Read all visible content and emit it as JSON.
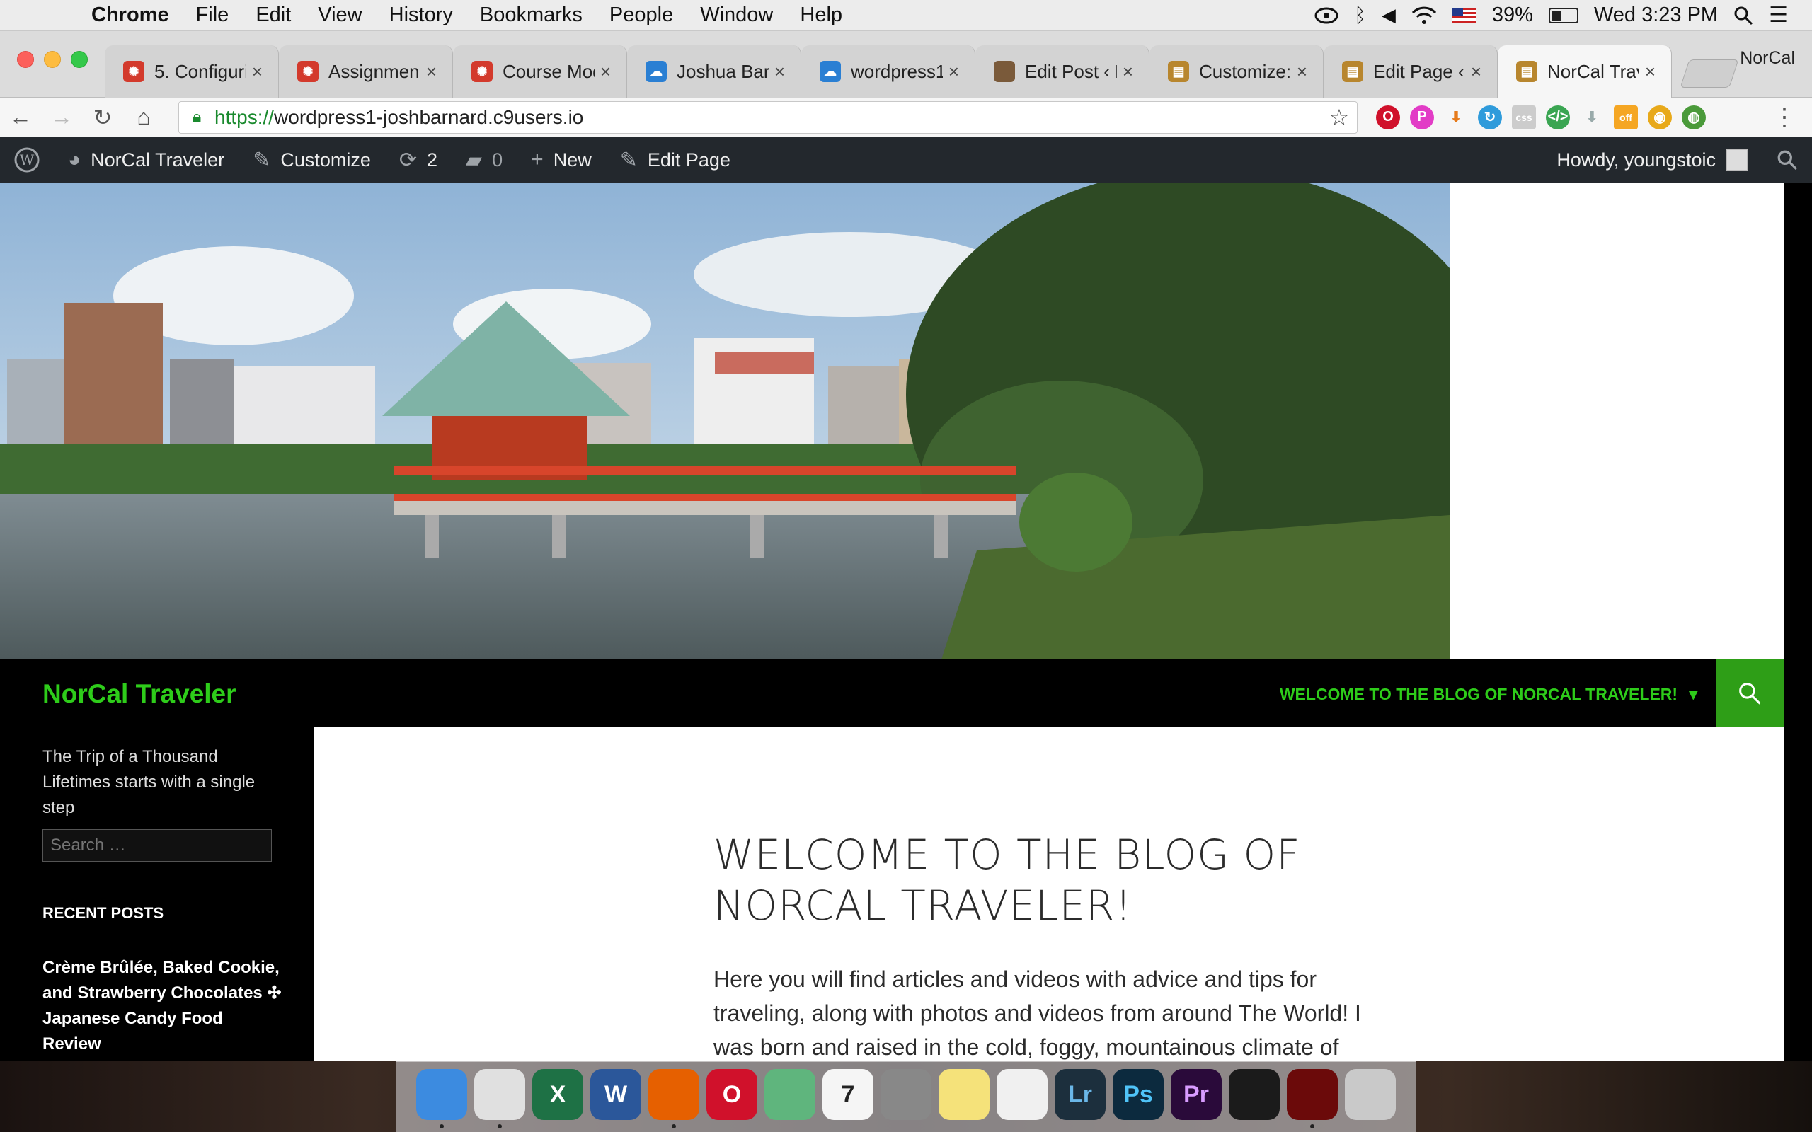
{
  "menubar": {
    "app": "Chrome",
    "items": [
      "File",
      "Edit",
      "View",
      "History",
      "Bookmarks",
      "People",
      "Window",
      "Help"
    ],
    "battery": "39%",
    "clock": "Wed 3:23 PM"
  },
  "tabs": [
    {
      "title": "5. Configuri",
      "favicon": "canvas-icon",
      "color": "#d33a2c"
    },
    {
      "title": "Assignment",
      "favicon": "canvas-icon",
      "color": "#d33a2c"
    },
    {
      "title": "Course Mod",
      "favicon": "canvas-icon",
      "color": "#d33a2c"
    },
    {
      "title": "Joshua Barn",
      "favicon": "cloud9-icon",
      "color": "#2a7fd3"
    },
    {
      "title": "wordpress1",
      "favicon": "cloud9-icon",
      "color": "#2a7fd3"
    },
    {
      "title": "Edit Post ‹ N",
      "favicon": "site-thumb-icon",
      "color": "#7a5a3a"
    },
    {
      "title": "Customize:",
      "favicon": "suitcase-icon",
      "color": "#b8862e"
    },
    {
      "title": "Edit Page ‹ N",
      "favicon": "suitcase-icon",
      "color": "#b8862e"
    },
    {
      "title": "NorCal Trave",
      "favicon": "suitcase-icon",
      "color": "#b8862e"
    }
  ],
  "profile": "NorCal",
  "omnibox": {
    "scheme": "https://",
    "host": "wordpress1-joshbarnard.c9users.io"
  },
  "adminbar": {
    "site": "NorCal Traveler",
    "customize": "Customize",
    "updates": "2",
    "comments": "0",
    "new": "New",
    "edit": "Edit Page",
    "howdy": "Howdy, youngstoic"
  },
  "site": {
    "title": "NorCal Traveler",
    "nav_item": "WELCOME TO THE BLOG OF NORCAL TRAVELER!",
    "tagline": "The Trip of a Thousand Lifetimes starts with a single step",
    "search_placeholder": "Search …",
    "recent_posts_title": "RECENT POSTS",
    "recent_post_1": "Crème Brûlée, Baked Cookie, and Strawberry Chocolates ✣ Japanese Candy Food Review"
  },
  "entry": {
    "title": "WELCOME TO THE BLOG OF NORCAL TRAVELER!",
    "text": "Here you will find articles and videos with advice and tips for traveling, along with photos and videos from around The World! I was born and raised in the cold, foggy, mountainous climate of"
  },
  "dock": [
    {
      "name": "finder",
      "label": "",
      "color": "#3c8be0"
    },
    {
      "name": "chrome",
      "label": "",
      "color": "#e0e0e0"
    },
    {
      "name": "excel",
      "label": "X",
      "color": "#1e7145"
    },
    {
      "name": "word",
      "label": "W",
      "color": "#2b579a"
    },
    {
      "name": "firefox",
      "label": "",
      "color": "#e66000"
    },
    {
      "name": "opera",
      "label": "O",
      "color": "#d0112b"
    },
    {
      "name": "atom",
      "label": "",
      "color": "#5fb57d"
    },
    {
      "name": "calendar",
      "label": "7",
      "color": "#f5f5f5"
    },
    {
      "name": "calculator",
      "label": "",
      "color": "#888"
    },
    {
      "name": "notes",
      "label": "",
      "color": "#f5e27a"
    },
    {
      "name": "photos",
      "label": "",
      "color": "#f0f0f0"
    },
    {
      "name": "lightroom",
      "label": "Lr",
      "color": "#1c2f3d"
    },
    {
      "name": "photoshop",
      "label": "Ps",
      "color": "#0c2a3e"
    },
    {
      "name": "premiere",
      "label": "Pr",
      "color": "#2a0a3a"
    },
    {
      "name": "terminal",
      "label": "",
      "color": "#1b1b1b"
    },
    {
      "name": "acrobat",
      "label": "",
      "color": "#6b0a0a"
    },
    {
      "name": "trash",
      "label": "",
      "color": "#c9c9c9"
    }
  ],
  "colors": {
    "accent_green": "#2ecc1a",
    "admin_bar": "#23282d",
    "search_green": "#2e9e17"
  }
}
